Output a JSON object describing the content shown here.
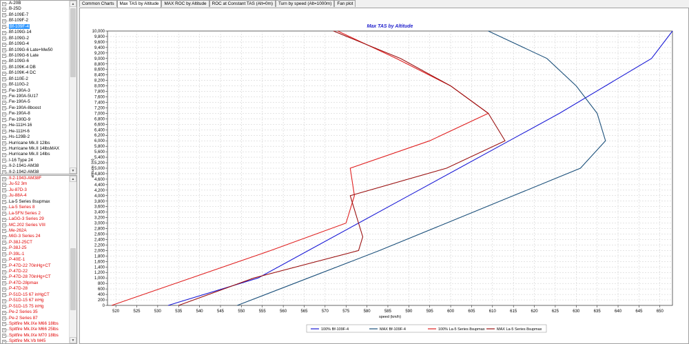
{
  "sidebar": {
    "top_items": [
      "A-20B",
      "B-25D",
      "Bf-109E-7",
      "Bf-109F-2",
      "Bf-109F-4",
      "Bf-109G-14",
      "Bf-109G-2",
      "Bf-109G-4",
      "Bf-109G-6 Late+Mw50",
      "Bf-109G-6 Late",
      "Bf-109G-6",
      "Bf-109K-4 DB",
      "Bf-109K-4 DC",
      "Bf-110E-2",
      "Bf-110G-2",
      "Fw-190A-3",
      "Fw-190A-5U17",
      "Fw-190A-5",
      "Fw-190A-8boost",
      "Fw-190A-8",
      "Fw-190D-9",
      "He-111H-16",
      "He-111H-6",
      "Hs-129B-2",
      "Hurricane Mk.II 12lbs",
      "Hurricane Mk.II 14lbsMAX",
      "Hurricane Mk.II 14lbs",
      "I-16 Type 24",
      "Il-2-1941-AM38",
      "Il-2-1942-AM38"
    ],
    "top_selected_index": 4,
    "bottom_items": [
      {
        "label": "Il-2-1943-AM38F",
        "color": "red"
      },
      {
        "label": "Ju-52 3m",
        "color": "red"
      },
      {
        "label": "Ju-87D-3",
        "color": "red"
      },
      {
        "label": "Ju-88A-4",
        "color": "red"
      },
      {
        "label": "La-5 Series 8supmax",
        "color": "black"
      },
      {
        "label": "La-5 Series 8",
        "color": "red"
      },
      {
        "label": "La-5FN Series 2",
        "color": "red"
      },
      {
        "label": "LaGG-3 Series 29",
        "color": "red"
      },
      {
        "label": "MC.202 Series VIII",
        "color": "red"
      },
      {
        "label": "Me-262A",
        "color": "red"
      },
      {
        "label": "MiG-3 Series 24",
        "color": "red"
      },
      {
        "label": "P-38J-25CT",
        "color": "red"
      },
      {
        "label": "P-38J-25",
        "color": "red"
      },
      {
        "label": "P-39L-1",
        "color": "red"
      },
      {
        "label": "P-40E-1",
        "color": "red"
      },
      {
        "label": "P-47D-22 70inHg+CT",
        "color": "red"
      },
      {
        "label": "P-47D-22",
        "color": "red"
      },
      {
        "label": "P-47D-28 70inHg+CT",
        "color": "red"
      },
      {
        "label": "P-47D-28pmax",
        "color": "red"
      },
      {
        "label": "P-47D-28",
        "color": "red"
      },
      {
        "label": "P-51D-15 67 inHgCT",
        "color": "red"
      },
      {
        "label": "P-51D-15 67 inHg",
        "color": "red"
      },
      {
        "label": "P-51D-15 75 inHg",
        "color": "red"
      },
      {
        "label": "Pe-2 Series 35",
        "color": "red"
      },
      {
        "label": "Pe-2 Series 87",
        "color": "red"
      },
      {
        "label": "Spitfire Mk.IXe M66 18lbs",
        "color": "red"
      },
      {
        "label": "Spitfire Mk.IXe M66 25lbs",
        "color": "red"
      },
      {
        "label": "Spitfire Mk.IXe M70 18lbs",
        "color": "red"
      },
      {
        "label": "Spitfire Mk.Vb M45",
        "color": "red"
      }
    ]
  },
  "tabs": [
    "Common Charts",
    "Max TAS by Altitude",
    "MAX ROC by Altitude",
    "ROC at Constant TAS (Alt=0m)",
    "Turn by speed (Alt=1000m)",
    "Fan plot"
  ],
  "active_tab": 1,
  "chart_data": {
    "type": "line",
    "title": "Max TAS by Altitude",
    "xlabel": "speed (km/h)",
    "ylabel": "altitude (m)",
    "xlim": [
      518,
      653
    ],
    "ylim": [
      0,
      10000
    ],
    "xticks": [
      520,
      525,
      530,
      535,
      540,
      545,
      550,
      555,
      560,
      565,
      570,
      575,
      580,
      585,
      590,
      595,
      600,
      605,
      610,
      615,
      620,
      625,
      630,
      635,
      640,
      645,
      650
    ],
    "ytick_step": 200,
    "grid": true,
    "legend_placement": "bottom",
    "series": [
      {
        "name": "100% Bf-109F-4",
        "color": "#1a1ad6",
        "points": [
          [
            532.5,
            0
          ],
          [
            554,
            1000
          ],
          [
            566,
            2000
          ],
          [
            578,
            3000
          ],
          [
            590,
            4000
          ],
          [
            602,
            5000
          ],
          [
            614,
            6000
          ],
          [
            626,
            7000
          ],
          [
            637,
            8000
          ],
          [
            648,
            9000
          ],
          [
            653,
            10000
          ]
        ]
      },
      {
        "name": "MAX Bf-109F-4",
        "color": "#1a4f7a",
        "points": [
          [
            549,
            0
          ],
          [
            566,
            1000
          ],
          [
            583,
            2000
          ],
          [
            599,
            3000
          ],
          [
            615,
            4000
          ],
          [
            631,
            5000
          ],
          [
            637,
            6000
          ],
          [
            635,
            7000
          ],
          [
            630,
            8000
          ],
          [
            623,
            9000
          ],
          [
            609,
            10000
          ]
        ]
      },
      {
        "name": "100% La-5 Series 8supmax",
        "color": "#e02020",
        "points": [
          [
            519,
            0
          ],
          [
            557,
            2000
          ],
          [
            575,
            3000
          ],
          [
            577,
            4000
          ],
          [
            576,
            5000
          ],
          [
            595,
            6000
          ],
          [
            609,
            7000
          ],
          [
            600,
            8000
          ],
          [
            587,
            9000
          ],
          [
            573,
            10000
          ]
        ]
      },
      {
        "name": "MAX La-5 Series 8supmax",
        "color": "#9a1010",
        "points": [
          [
            535,
            0
          ],
          [
            553,
            1000
          ],
          [
            578,
            2000
          ],
          [
            579,
            2500
          ],
          [
            578,
            3000
          ],
          [
            576,
            4000
          ],
          [
            599,
            5000
          ],
          [
            613,
            6000
          ],
          [
            609,
            7000
          ],
          [
            600,
            8000
          ],
          [
            588,
            9000
          ],
          [
            572,
            10000
          ]
        ]
      }
    ]
  }
}
